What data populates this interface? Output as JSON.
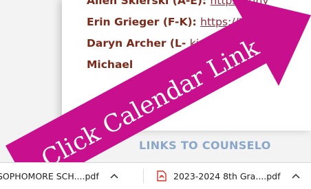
{
  "document": {
    "counselors": [
      {
        "name": "Allen Sklerski (A-E):",
        "link": "https://tiny"
      },
      {
        "name": "Erin Grieger (F-K):",
        "link": "https://tiny"
      },
      {
        "name": "Daryn Archer (L-",
        "link": "kin"
      },
      {
        "name": "Michael",
        "link": "https"
      }
    ],
    "links_heading": "LINKS TO COUNSELO"
  },
  "overlay": {
    "arrow_text": "Click Calendar Link",
    "arrow_color": "#c8108f"
  },
  "downloads": {
    "items": [
      {
        "name": "SOPHOMORE SCH....pdf",
        "icon": "pdf-icon"
      },
      {
        "name": "2023-2024 8th Gra....pdf",
        "icon": "pdf-icon"
      }
    ]
  }
}
